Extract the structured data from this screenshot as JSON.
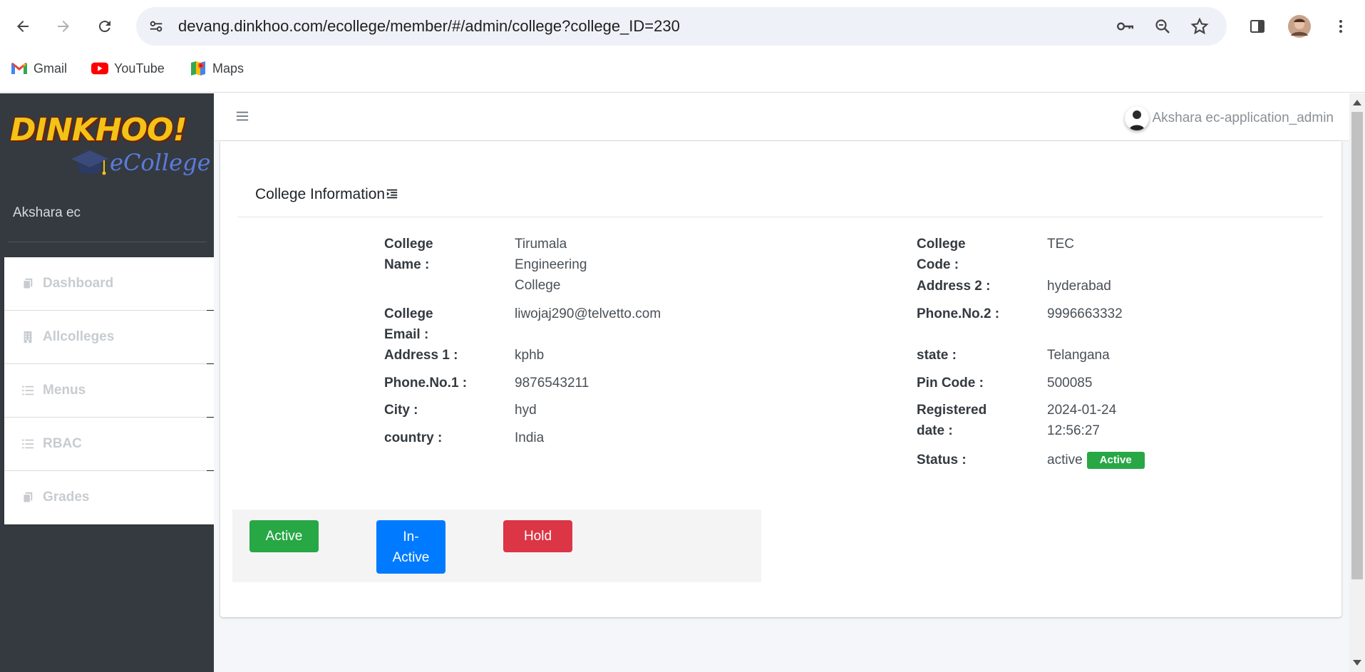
{
  "browser": {
    "url": "devang.dinkhoo.com/ecollege/member/#/admin/college?college_ID=230",
    "bookmarks": [
      {
        "label": "Gmail",
        "icon": "gmail-icon"
      },
      {
        "label": "YouTube",
        "icon": "youtube-icon"
      },
      {
        "label": "Maps",
        "icon": "maps-icon"
      }
    ]
  },
  "sidebar": {
    "logo_text": "DINKHOO!",
    "logo_subtext": "eCollege",
    "user_name": "Akshara ec",
    "items": [
      {
        "label": "Dashboard",
        "icon": "copy-icon"
      },
      {
        "label": "Allcolleges",
        "icon": "building-icon"
      },
      {
        "label": "Menus",
        "icon": "list-icon"
      },
      {
        "label": "RBAC",
        "icon": "list-icon"
      },
      {
        "label": "Grades",
        "icon": "copy-icon"
      }
    ]
  },
  "topbar": {
    "user_label": "Akshara ec-application_admin"
  },
  "card": {
    "title": "College Information",
    "left_fields": [
      {
        "label": "College Name :",
        "value": "Tirumala Engineering College"
      },
      {
        "label": "College Email :",
        "value": "liwojaj290@telvetto.com"
      },
      {
        "label": "Address 1 :",
        "value": "kphb"
      },
      {
        "label": "Phone.No.1 :",
        "value": "9876543211"
      },
      {
        "label": "City :",
        "value": "hyd"
      },
      {
        "label": "country :",
        "value": "India"
      }
    ],
    "right_fields": [
      {
        "label": "College Code :",
        "value": "TEC"
      },
      {
        "label": "Address 2 :",
        "value": "hyderabad"
      },
      {
        "label": "Phone.No.2 :",
        "value": "9996663332"
      },
      {
        "label": "state :",
        "value": "Telangana"
      },
      {
        "label": "Pin Code :",
        "value": "500085"
      },
      {
        "label": "Registered date :",
        "value": "2024-01-24 12:56:27"
      },
      {
        "label": "Status :",
        "value": "active"
      }
    ],
    "status_badge": "Active",
    "buttons": {
      "active": "Active",
      "inactive": "In-Active",
      "hold": "Hold"
    }
  },
  "colors": {
    "sidebar_bg": "#343a40",
    "success": "#28a745",
    "primary": "#007bff",
    "danger": "#dc3545"
  }
}
